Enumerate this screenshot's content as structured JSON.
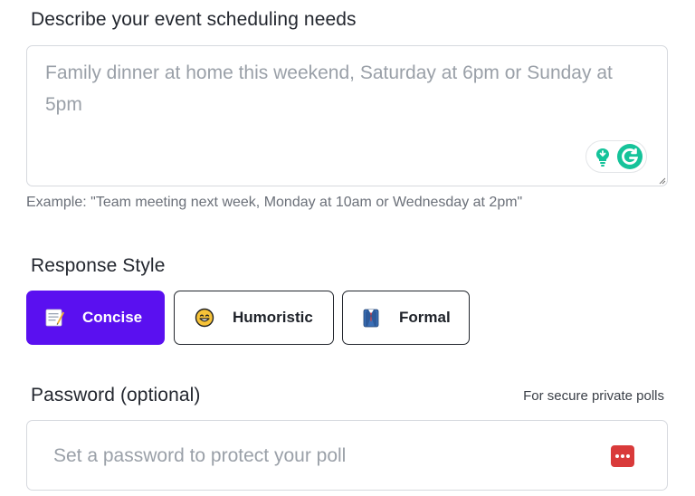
{
  "description": {
    "label": "Describe your event scheduling needs",
    "placeholder": "Family dinner at home this weekend, Saturday at 6pm or Sunday at 5pm",
    "example": "Example: \"Team meeting next week, Monday at 10am or Wednesday at 2pm\""
  },
  "response_style": {
    "label": "Response Style",
    "options": [
      {
        "label": "Concise",
        "icon": "memo-icon",
        "selected": true
      },
      {
        "label": "Humoristic",
        "icon": "grinning-face-icon",
        "selected": false
      },
      {
        "label": "Formal",
        "icon": "suit-icon",
        "selected": false
      }
    ]
  },
  "password": {
    "label": "Password (optional)",
    "hint": "For secure private polls",
    "placeholder": "Set a password to protect your poll"
  },
  "colors": {
    "accent": "#5a10f0",
    "grammarly_green": "#15c39a",
    "password_manager_red": "#d93a3a"
  }
}
